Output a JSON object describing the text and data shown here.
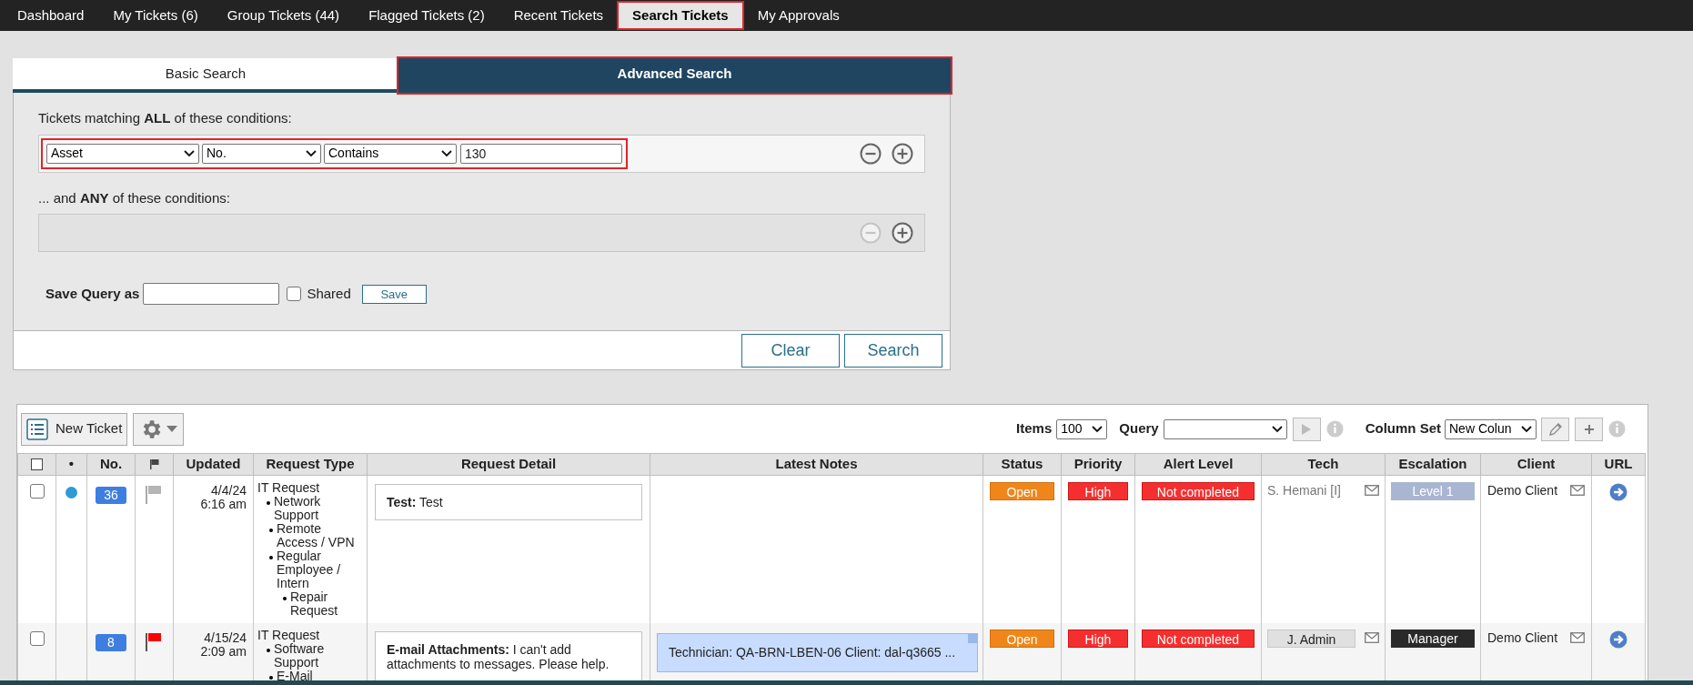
{
  "nav_tabs": [
    {
      "label": "Dashboard",
      "selected": false,
      "highlighted": false
    },
    {
      "label": "My Tickets (6)",
      "selected": false,
      "highlighted": false
    },
    {
      "label": "Group Tickets (44)",
      "selected": false,
      "highlighted": false
    },
    {
      "label": "Flagged Tickets (2)",
      "selected": false,
      "highlighted": false
    },
    {
      "label": "Recent Tickets",
      "selected": false,
      "highlighted": false
    },
    {
      "label": "Search Tickets",
      "selected": true,
      "highlighted": true
    },
    {
      "label": "My Approvals",
      "selected": false,
      "highlighted": false
    }
  ],
  "search_tabs": [
    {
      "label": "Basic Search",
      "selected": false,
      "highlighted": false
    },
    {
      "label": "Advanced Search",
      "selected": true,
      "highlighted": true
    }
  ],
  "all_conditions": {
    "label": "Tickets matching **ALL** of these conditions:",
    "remove_disabled": false,
    "rows": [
      {
        "field": "Asset",
        "subfield": "No.",
        "operator": "Contains",
        "value": "130",
        "highlighted": true
      }
    ]
  },
  "any_conditions": {
    "label": "... and **ANY** of these conditions:",
    "remove_disabled": true
  },
  "save_query": {
    "label": "Save Query as",
    "shared_label": "Shared",
    "shared_checked": false,
    "save_button": "Save"
  },
  "actions": [
    "Clear",
    "Search"
  ],
  "toolbar": {
    "new_ticket": "New Ticket",
    "items_label": "Items",
    "items_value": "100",
    "query_label": "Query",
    "column_set_label": "Column Set",
    "column_set_value": "New Colun"
  },
  "table": {
    "columns": [
      {
        "kind": "checkbox",
        "checked": false
      },
      {
        "kind": "text",
        "label": "•"
      },
      {
        "kind": "text",
        "label": "No."
      },
      {
        "kind": "flag"
      },
      {
        "kind": "text",
        "label": "Updated"
      },
      {
        "kind": "text",
        "label": "Request Type"
      },
      {
        "kind": "text",
        "label": "Request Detail"
      },
      {
        "kind": "text",
        "label": "Latest Notes"
      },
      {
        "kind": "text",
        "label": "Status"
      },
      {
        "kind": "text",
        "label": "Priority"
      },
      {
        "kind": "text",
        "label": "Alert Level"
      },
      {
        "kind": "text",
        "label": "Tech"
      },
      {
        "kind": "text",
        "label": "Escalation"
      },
      {
        "kind": "text",
        "label": "Client"
      },
      {
        "kind": "text",
        "label": "URL"
      }
    ],
    "rows": [
      {
        "checked": false,
        "unread": true,
        "number": "36",
        "flagged": false,
        "date": "4/4/24",
        "time": "6:16 am",
        "request_type": {
          "label": "IT Request",
          "children": [
            {
              "label": "Network Support",
              "children": [
                {
                  "label": "Remote Access / VPN"
                },
                {
                  "label": "Regular Employee / Intern",
                  "children": [
                    {
                      "label": "Repair Request"
                    }
                  ]
                }
              ]
            }
          ]
        },
        "detail": "**Test:** Test",
        "status": "Open",
        "priority": "High",
        "alert": "Not completed",
        "tech": {
          "name": "S. Hemani [I]",
          "kind": "plain"
        },
        "escalation": {
          "label": "Level 1",
          "color": "#a9b6d2"
        },
        "client": "Demo Client"
      },
      {
        "checked": false,
        "unread": false,
        "number": "8",
        "flagged": true,
        "date": "4/15/24",
        "time": "2:09 am",
        "request_type": {
          "label": "IT Request",
          "children": [
            {
              "label": "Software Support",
              "children": [
                {
                  "label": "E-Mail"
                }
              ]
            }
          ]
        },
        "detail": "**E-mail Attachments:** I can't add attachments to messages. Please help.",
        "notes": [
          "Technician: QA-BRN-LBEN-06 Client: dal-q3665 ..."
        ],
        "status": "Open",
        "priority": "High",
        "alert": "Not completed",
        "tech": {
          "name": "J. Admin",
          "kind": "boxed"
        },
        "escalation": {
          "label": "Manager",
          "color": "#2a2a2a"
        },
        "client": "Demo Client"
      }
    ]
  }
}
